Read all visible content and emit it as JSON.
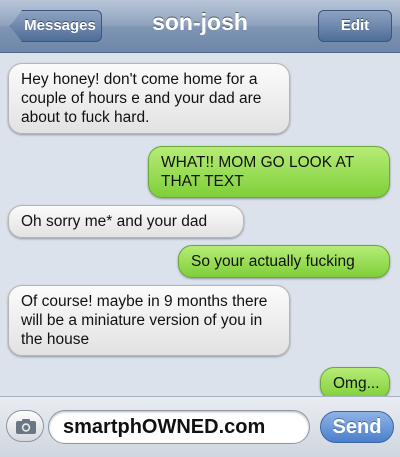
{
  "header": {
    "back_label": "Messages",
    "title": "son-josh",
    "edit_label": "Edit"
  },
  "messages": [
    {
      "direction": "incoming",
      "text": "Hey honey! don't come home for a couple of hours e and your dad are about to fuck hard."
    },
    {
      "direction": "outgoing",
      "text": "WHAT!! MOM GO LOOK AT THAT TEXT"
    },
    {
      "direction": "incoming",
      "text": "Oh sorry me* and your dad"
    },
    {
      "direction": "outgoing",
      "text": "So your actually fucking"
    },
    {
      "direction": "incoming",
      "text": "Of course! maybe in 9 months there will be a miniature version of you in the house"
    },
    {
      "direction": "outgoing",
      "text": "Omg..."
    }
  ],
  "composer": {
    "input_value": "smartphOWNED.com",
    "send_label": "Send",
    "camera_icon": "camera-icon"
  },
  "colors": {
    "outgoing_bubble": "#8fd84a",
    "incoming_bubble": "#ececec",
    "nav_bar": "#7f95b4",
    "send_button": "#4b7fcc"
  }
}
